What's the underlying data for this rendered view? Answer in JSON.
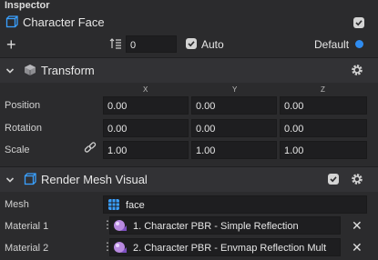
{
  "panel": {
    "title": "Inspector"
  },
  "object": {
    "name": "Character Face",
    "enabled": true
  },
  "layer": {
    "order_value": "0",
    "auto_label": "Auto",
    "auto_checked": true,
    "layer_label": "Default"
  },
  "transform": {
    "title": "Transform",
    "axes": [
      "X",
      "Y",
      "Z"
    ],
    "rows": [
      {
        "label": "Position",
        "values": [
          "0.00",
          "0.00",
          "0.00"
        ]
      },
      {
        "label": "Rotation",
        "values": [
          "0.00",
          "0.00",
          "0.00"
        ]
      },
      {
        "label": "Scale",
        "values": [
          "1.00",
          "1.00",
          "1.00"
        ]
      }
    ]
  },
  "render": {
    "title": "Render Mesh Visual",
    "enabled": true,
    "mesh_label": "Mesh",
    "mesh_value": "face",
    "materials": [
      {
        "label": "Material 1",
        "value": "1. Character PBR - Simple Reflection"
      },
      {
        "label": "Material 2",
        "value": "2. Character PBR - Envmap Reflection Mult"
      }
    ]
  },
  "colors": {
    "accent": "#2f8cf0",
    "bg": "#2b2b2d",
    "field": "#1e1e20"
  }
}
